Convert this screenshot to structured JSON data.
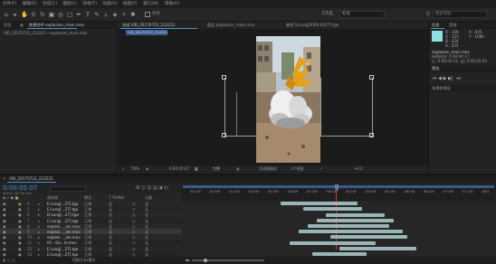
{
  "menubar": [
    "文件(F)",
    "编辑(E)",
    "合成(C)",
    "图层(L)",
    "效果(T)",
    "动画(A)",
    "视图(V)",
    "窗口(W)",
    "帮助(H)"
  ],
  "toolbar": {
    "snap_label": "对齐",
    "workspace_label": "工作区",
    "workspace_value": "标准",
    "search_placeholder": "搜索帮助"
  },
  "project": {
    "tab_label": "项目",
    "effects_tab_label": "效果控件",
    "effects_tab_item": "explosion_main.mov",
    "item_name": "VID_20170722_212221 • explosion_main.mov"
  },
  "composition": {
    "tab_label": "合成 VID_20170722_212221",
    "tab2_label": "图层 explosion_main.mov",
    "tab3_label": "素材 S-Long[0000-0027].tga",
    "subtab_label": "VID_20170722_212221",
    "bottom": {
      "zoom": "50%",
      "timecode": "0:00:05:07",
      "quality": "完整",
      "camera": "活动摄像机",
      "views": "1个视图",
      "offset": "+0.0"
    }
  },
  "info": {
    "tab_label": "信息",
    "audio_tab_label": "音频",
    "r": "R : 140",
    "g": "G : 225",
    "b": "B : 224",
    "a": "A : 255",
    "x": "X : 825",
    "y": "Y : 1084",
    "file_name": "explosion_main.mov",
    "file_line2": "持续时间: 0:00:04:17",
    "file_line3": "入: 0:00:00:12, 出: 0:00:05:03"
  },
  "preview": {
    "tab_label": "预览",
    "effects_presets_label": "效果和预设"
  },
  "timeline": {
    "comp_tab": "VID_20170722_212221",
    "timecode": "0:00:05:07",
    "fps": "00157 (30.00 fps)",
    "search_placeholder": "",
    "col_source": "源名称",
    "col_mode": "模式",
    "col_trkmat": "T TrkMat",
    "col_parent": "父级",
    "ruler": [
      "00:15f",
      "01:00f",
      "01:15f",
      "02:00f",
      "02:15f",
      "03:00f",
      "03:15f",
      "04:00f",
      "04:15f",
      "05:00f",
      "05:15f",
      "06:00f",
      "06:15f",
      "07:00f",
      "07:15f",
      "08:0"
    ],
    "footer_label": "切换开关/模式",
    "layers": [
      {
        "num": "4",
        "name": "E-Long[...27].tga",
        "mode": "正常",
        "trk": "无",
        "parent": "无"
      },
      {
        "num": "5",
        "name": "E-Long[...27].tga",
        "mode": "正常",
        "trk": "无",
        "parent": "无"
      },
      {
        "num": "6",
        "name": "D-Long[...27].tga",
        "mode": "正常",
        "trk": "无",
        "parent": "无"
      },
      {
        "num": "7",
        "name": "C-Long[...27].tga",
        "mode": "正常",
        "trk": "无",
        "parent": "无"
      },
      {
        "num": "8",
        "name": "explosi..._ain.mov",
        "mode": "正常",
        "trk": "无",
        "parent": "无"
      },
      {
        "num": "9",
        "name": "explosi..._ain.mov",
        "mode": "正常",
        "trk": "无",
        "parent": "无"
      },
      {
        "num": "10",
        "name": "explosi..._ain.mov",
        "mode": "正常",
        "trk": "无",
        "parent": "无"
      },
      {
        "num": "11",
        "name": "01 - Dn...le.mov",
        "mode": "正常",
        "trk": "无",
        "parent": "无"
      },
      {
        "num": "12",
        "name": "E-Long[...27].tga",
        "mode": "正常",
        "trk": "无",
        "parent": "无"
      },
      {
        "num": "13",
        "name": "E-Long[...27].tga",
        "mode": "正常",
        "trk": "无",
        "parent": "无"
      }
    ]
  }
}
